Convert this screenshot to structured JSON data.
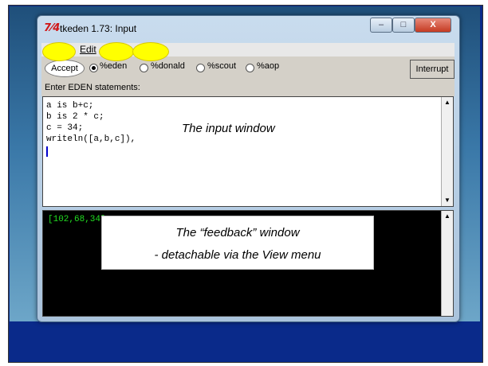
{
  "window": {
    "title": "tkeden 1.73: Input",
    "icon_glyph": "7⁄4",
    "controls": {
      "minimize": "–",
      "maximize": "□",
      "close": "X"
    }
  },
  "menu": {
    "edit": "Edit"
  },
  "toolbar": {
    "accept": "Accept",
    "notations": [
      "%eden",
      "%donald",
      "%scout",
      "%aop"
    ],
    "selected_notation": "%eden",
    "interrupt": "Interrupt",
    "prompt": "Enter EDEN statements:"
  },
  "input": {
    "code": "a is b+c;\nb is 2 * c;\nc = 34;\nwriteln([a,b,c]),",
    "annotation": "The input window"
  },
  "feedback": {
    "output": "[102,68,34]",
    "annotation_line1": "The “feedback” window",
    "annotation_line2": "- detachable via the View menu"
  },
  "colors": {
    "slide_bg": "#0a2a8a",
    "highlight": "#ffff00",
    "feedback_text": "#22dd22",
    "close_button": "#c53a22"
  }
}
